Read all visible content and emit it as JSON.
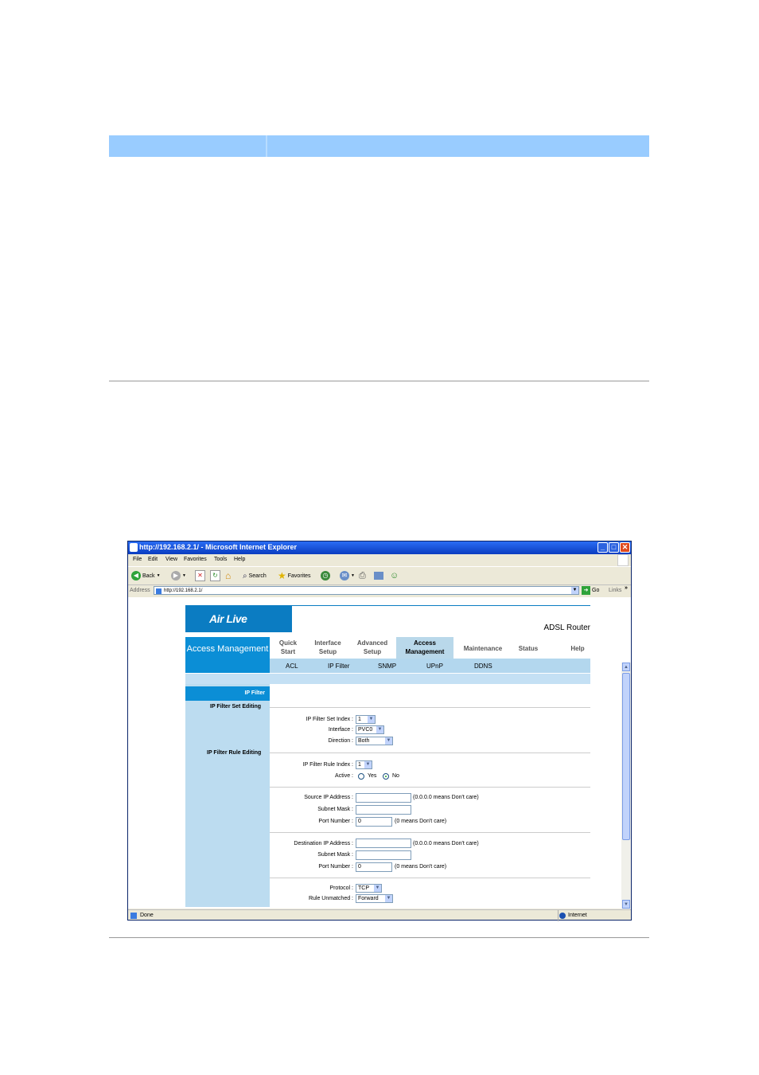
{
  "browser": {
    "title": "http://192.168.2.1/ - Microsoft Internet Explorer",
    "menu": [
      "File",
      "Edit",
      "View",
      "Favorites",
      "Tools",
      "Help"
    ],
    "toolbar": {
      "back": "Back",
      "search": "Search",
      "favorites": "Favorites"
    },
    "address_label": "Address",
    "address_value": "http://192.168.2.1/",
    "go": "Go",
    "links": "Links",
    "status_left": "Done",
    "status_right": "Internet"
  },
  "router": {
    "logo": "Air Live",
    "product": "ADSL Router",
    "section": "Access Management",
    "tabs": [
      {
        "label": "Quick Start"
      },
      {
        "label": "Interface Setup"
      },
      {
        "label": "Advanced Setup"
      },
      {
        "label": "Access Management"
      },
      {
        "label": "Maintenance"
      },
      {
        "label": "Status"
      },
      {
        "label": "Help"
      }
    ],
    "active_tab": "Access Management",
    "subtabs": [
      "ACL",
      "IP Filter",
      "SNMP",
      "UPnP",
      "DDNS"
    ],
    "page_head": "IP Filter",
    "set_editing": "IP Filter Set Editing",
    "rule_editing": "IP Filter Rule Editing",
    "fields": {
      "set_index": {
        "label": "IP Filter Set Index :",
        "value": "1"
      },
      "interface": {
        "label": "Interface :",
        "value": "PVC0"
      },
      "direction": {
        "label": "Direction :",
        "value": "Both"
      },
      "rule_index": {
        "label": "IP Filter Rule Index :",
        "value": "1"
      },
      "active": {
        "label": "Active :",
        "options": [
          "Yes",
          "No"
        ],
        "selected": "No"
      },
      "src_ip": {
        "label": "Source IP Address :",
        "value": "",
        "note": "(0.0.0.0 means Don't care)"
      },
      "src_mask": {
        "label": "Subnet Mask :",
        "value": ""
      },
      "src_port": {
        "label": "Port Number :",
        "value": "0",
        "note": "(0 means Don't care)"
      },
      "dst_ip": {
        "label": "Destination IP Address :",
        "value": "",
        "note": "(0.0.0.0 means Don't care)"
      },
      "dst_mask": {
        "label": "Subnet Mask :",
        "value": ""
      },
      "dst_port": {
        "label": "Port Number :",
        "value": "0",
        "note": "(0 means Don't care)"
      },
      "protocol": {
        "label": "Protocol :",
        "value": "TCP"
      },
      "rule_unmatched": {
        "label": "Rule Unmatched :",
        "value": "Forward"
      }
    }
  },
  "colors": {
    "header_bar": "#99ccff",
    "brand_blue": "#0b8ed6",
    "sidebar": "#bcdcf0"
  }
}
